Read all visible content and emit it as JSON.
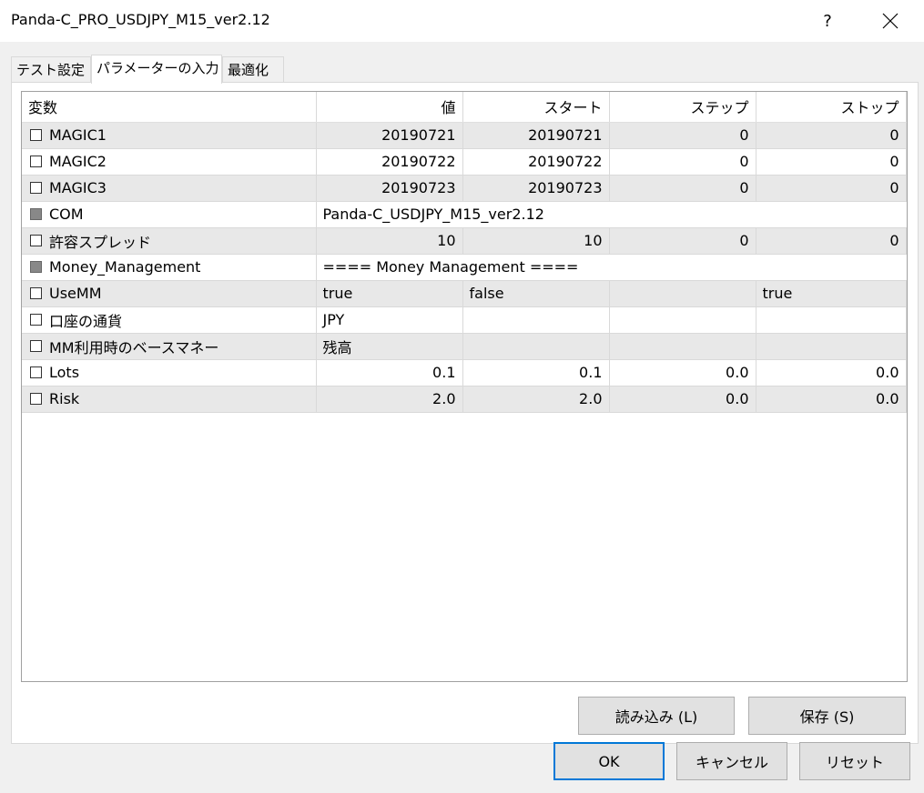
{
  "window": {
    "title": "Panda-C_PRO_USDJPY_M15_ver2.12",
    "help": "?"
  },
  "tabs": [
    {
      "label": "テスト設定"
    },
    {
      "label": "パラメーターの入力"
    },
    {
      "label": "最適化"
    }
  ],
  "table": {
    "headers": {
      "variable": "変数",
      "value": "値",
      "start": "スタート",
      "step": "ステップ",
      "stop": "ストップ"
    },
    "rows": [
      {
        "name": "MAGIC1",
        "value": "20190721",
        "start": "20190721",
        "step": "0",
        "stop": "0"
      },
      {
        "name": "MAGIC2",
        "value": "20190722",
        "start": "20190722",
        "step": "0",
        "stop": "0"
      },
      {
        "name": "MAGIC3",
        "value": "20190723",
        "start": "20190723",
        "step": "0",
        "stop": "0"
      },
      {
        "name": "COM",
        "value": "Panda-C_USDJPY_M15_ver2.12"
      },
      {
        "name": "許容スプレッド",
        "value": "10",
        "start": "10",
        "step": "0",
        "stop": "0"
      },
      {
        "name": "Money_Management",
        "value": "==== Money Management ===="
      },
      {
        "name": "UseMM",
        "value": "true",
        "start": "false",
        "step": "",
        "stop": "true"
      },
      {
        "name": "口座の通貨",
        "value": "JPY",
        "start": "",
        "step": "",
        "stop": ""
      },
      {
        "name": "MM利用時のベースマネー",
        "value": "残高",
        "start": "",
        "step": "",
        "stop": ""
      },
      {
        "name": "Lots",
        "value": "0.1",
        "start": "0.1",
        "step": "0.0",
        "stop": "0.0"
      },
      {
        "name": "Risk",
        "value": "2.0",
        "start": "2.0",
        "step": "0.0",
        "stop": "0.0"
      }
    ]
  },
  "buttons": {
    "load": "読み込み (L)",
    "save": "保存 (S)",
    "ok": "OK",
    "cancel": "キャンセル",
    "reset": "リセット"
  }
}
